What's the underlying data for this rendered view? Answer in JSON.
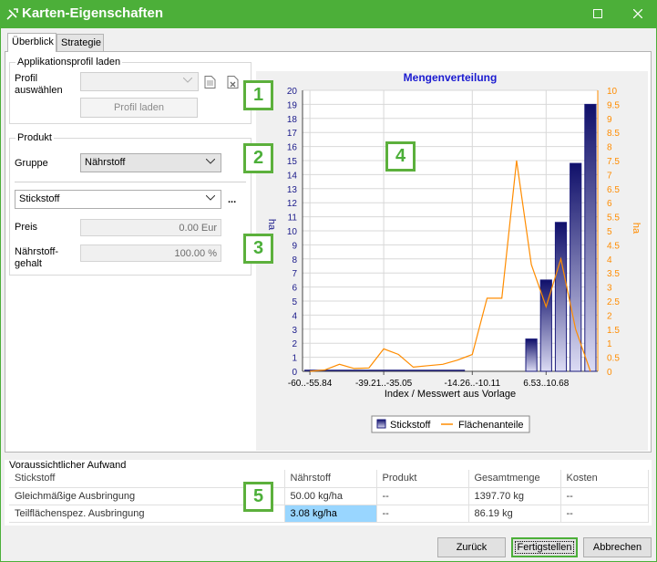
{
  "window": {
    "title": "Karten-Eigenschaften"
  },
  "tabs": [
    {
      "label": "Überblick",
      "active": true
    },
    {
      "label": "Strategie",
      "active": false
    }
  ],
  "profile": {
    "group_title": "Applikationsprofil laden",
    "select_label": "Profil auswählen",
    "select_value": "",
    "load_button": "Profil laden"
  },
  "product": {
    "group_title": "Produkt",
    "group_label": "Gruppe",
    "group_value": "Nährstoff",
    "product_value": "Stickstoff",
    "more_button": "...",
    "price_label": "Preis",
    "price_value": "0.00 Eur",
    "nutrient_label_1": "Nährstoff-",
    "nutrient_label_2": "gehalt",
    "nutrient_value": "100.00 %"
  },
  "badges": [
    "1",
    "2",
    "3",
    "4",
    "5"
  ],
  "colors": {
    "accent": "#4caf39",
    "bar": "#1a1a7a",
    "line": "#ff8c00",
    "chart_title": "#1a1ad0",
    "selection": "#99d6ff"
  },
  "chart_data": {
    "type": "bar",
    "title": "Mengenverteilung",
    "xlabel": "Index / Messwert aus Vorlage",
    "ylabel_left": "ha",
    "ylabel_right": "ha",
    "ylim_left": [
      0,
      20
    ],
    "ylim_right": [
      0,
      10
    ],
    "x_tick_labels": [
      "-60..-55.84",
      "-39.21..-35.05",
      "-14.26..-10.11",
      "6.53..10.68"
    ],
    "x_tick_positions": [
      0.5,
      5.5,
      11.5,
      16.5
    ],
    "bins": 20,
    "grid": true,
    "legend_position": "bottom",
    "series": [
      {
        "name": "Stickstoff",
        "kind": "bar",
        "axis": "left",
        "values": [
          0.05,
          0,
          0,
          0,
          0,
          0,
          0,
          0,
          0,
          0,
          0,
          0,
          0,
          0,
          0,
          0,
          2.3,
          6.5,
          10.6,
          14.8,
          19
        ]
      },
      {
        "name": "Flächenanteile",
        "kind": "line",
        "axis": "right",
        "values": [
          0,
          0.05,
          0.25,
          0.1,
          0.12,
          0.8,
          0.6,
          0.15,
          0.2,
          0.25,
          0.4,
          0.6,
          2.6,
          2.6,
          7.5,
          3.8,
          2.3,
          4.0,
          1.5,
          0
        ]
      }
    ],
    "legend": [
      "Stickstoff",
      "Flächenanteile"
    ]
  },
  "effort": {
    "title": "Voraussichtlicher Aufwand",
    "columns": [
      "Stickstoff",
      "Nährstoff",
      "Produkt",
      "Gesamtmenge",
      "Kosten"
    ],
    "rows": [
      [
        "Gleichmäßige Ausbringung",
        "50.00 kg/ha",
        "--",
        "1397.70 kg",
        "--"
      ],
      [
        "Teilflächenspez. Ausbringung",
        "3.08 kg/ha",
        "--",
        "86.19 kg",
        "--"
      ]
    ]
  },
  "footer": {
    "back": "Zurück",
    "finish": "Fertigstellen",
    "cancel": "Abbrechen"
  }
}
